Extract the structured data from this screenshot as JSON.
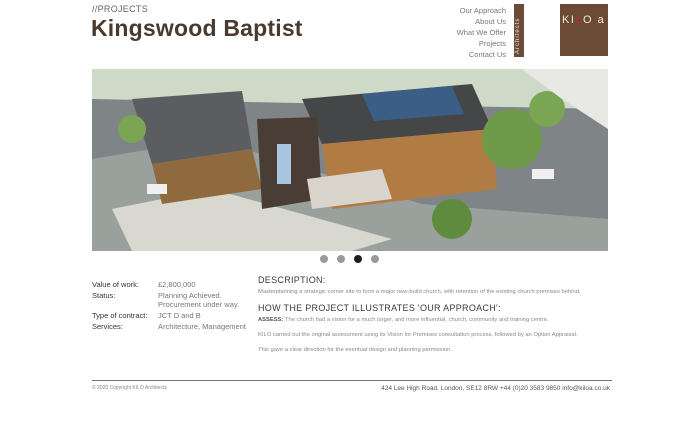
{
  "header": {
    "breadcrumb": "//PROJECTS",
    "title": "Kingswood Baptist"
  },
  "nav": {
    "items": [
      "Our Approach",
      "About Us",
      "What We Offer",
      "Projects",
      "Contact Us"
    ]
  },
  "brand": {
    "strip_text": "Architects",
    "logo_prefix": "KI",
    "logo_accent": "L",
    "logo_suffix": "O a",
    "color": "#6b4a36",
    "accent_color": "#d0204a"
  },
  "carousel": {
    "slide_count": 4,
    "active_index": 2
  },
  "facts": [
    {
      "label": "Value of work:",
      "value": "£2,800,000"
    },
    {
      "label": "Status:",
      "value": "Planning Achieved. Procurement under way."
    },
    {
      "label": "Type of contract:",
      "value": "JCT D and B"
    },
    {
      "label": "Services:",
      "value": "Architecture, Management"
    }
  ],
  "description": {
    "heading": "DESCRIPTION:",
    "text": "Masterplanning a strategic corner site to form a major new-build church, with retention of the existing church premises behind."
  },
  "approach": {
    "heading": "HOW THE PROJECT ILLUSTRATES 'OUR APPROACH':",
    "assess_label": "ASSESS:",
    "assess_text": " The church had a vision for a much larger, and more influential, church, community and training centre.",
    "para2": "KILO carried out the original assessment using its Vision for Premises consultation process, followed by an Option Appraisal.",
    "para3": "This gave a clear direction for the eventual design and planning permission."
  },
  "footer": {
    "copyright": "© 2020 Copyright KILO Architects",
    "contact": "424 Lee High Road, London, SE12 8RW +44 (0)20 3583 9850 info@kiloa.co.uk"
  }
}
